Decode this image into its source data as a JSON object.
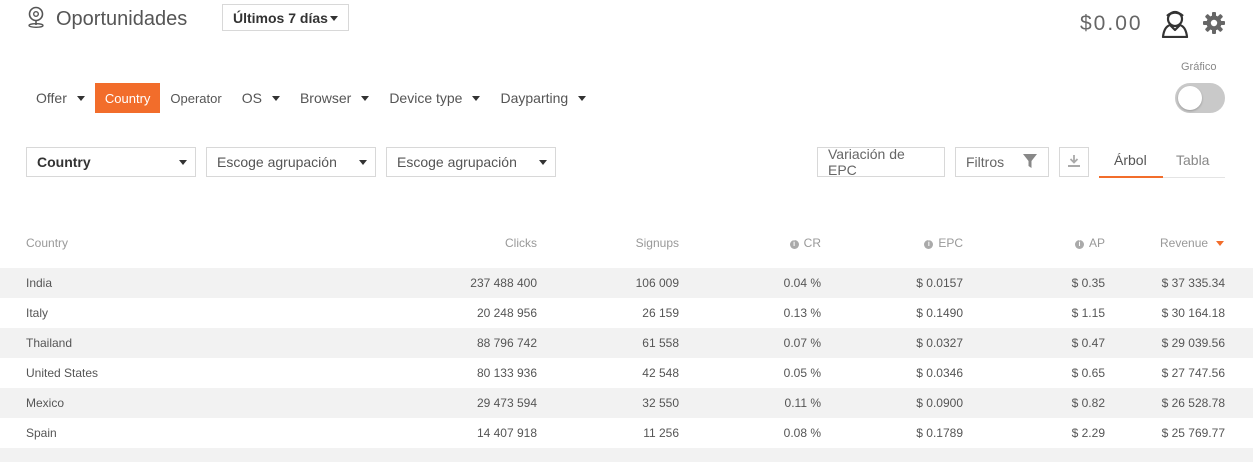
{
  "header": {
    "title": "Oportunidades",
    "period": "Últimos 7 días",
    "balance": "$0.00",
    "icons": [
      "map-pin-icon",
      "user-icon",
      "gear-icon"
    ]
  },
  "tabs": [
    {
      "label": "Offer",
      "dropdown": true,
      "active": false
    },
    {
      "label": "Country",
      "dropdown": false,
      "active": true
    },
    {
      "label": "Operator",
      "dropdown": false,
      "active": false
    },
    {
      "label": "OS",
      "dropdown": true,
      "active": false
    },
    {
      "label": "Browser",
      "dropdown": true,
      "active": false
    },
    {
      "label": "Device type",
      "dropdown": true,
      "active": false
    },
    {
      "label": "Dayparting",
      "dropdown": true,
      "active": false
    }
  ],
  "chart_toggle": {
    "label": "Gráfico",
    "on": false
  },
  "grouping": {
    "first": "Country",
    "second": "Escoge agrupación",
    "third": "Escoge agrupación"
  },
  "toolbar": {
    "epc_variation": "Variación de EPC",
    "filters": "Filtros",
    "view_tree": "Árbol",
    "view_table": "Tabla",
    "active_view": "Árbol"
  },
  "table": {
    "columns": [
      "Country",
      "Clicks",
      "Signups",
      "CR",
      "EPC",
      "AP",
      "Revenue"
    ],
    "sorted_by": "Revenue",
    "rows": [
      [
        "India",
        "237 488 400",
        "106 009",
        "0.04 %",
        "$ 0.0157",
        "$ 0.35",
        "$ 37 335.34"
      ],
      [
        "Italy",
        "20 248 956",
        "26 159",
        "0.13 %",
        "$ 0.1490",
        "$ 1.15",
        "$ 30 164.18"
      ],
      [
        "Thailand",
        "88 796 742",
        "61 558",
        "0.07 %",
        "$ 0.0327",
        "$ 0.47",
        "$ 29 039.56"
      ],
      [
        "United States",
        "80 133 936",
        "42 548",
        "0.05 %",
        "$ 0.0346",
        "$ 0.65",
        "$ 27 747.56"
      ],
      [
        "Mexico",
        "29 473 594",
        "32 550",
        "0.11 %",
        "$ 0.0900",
        "$ 0.82",
        "$ 26 528.78"
      ],
      [
        "Spain",
        "14 407 918",
        "11 256",
        "0.08 %",
        "$ 0.1789",
        "$ 2.29",
        "$ 25 769.77"
      ]
    ]
  },
  "colors": {
    "accent": "#f26d2b",
    "alt_row": "#f2f2f2",
    "toggle_off": "#c9c9c9"
  }
}
